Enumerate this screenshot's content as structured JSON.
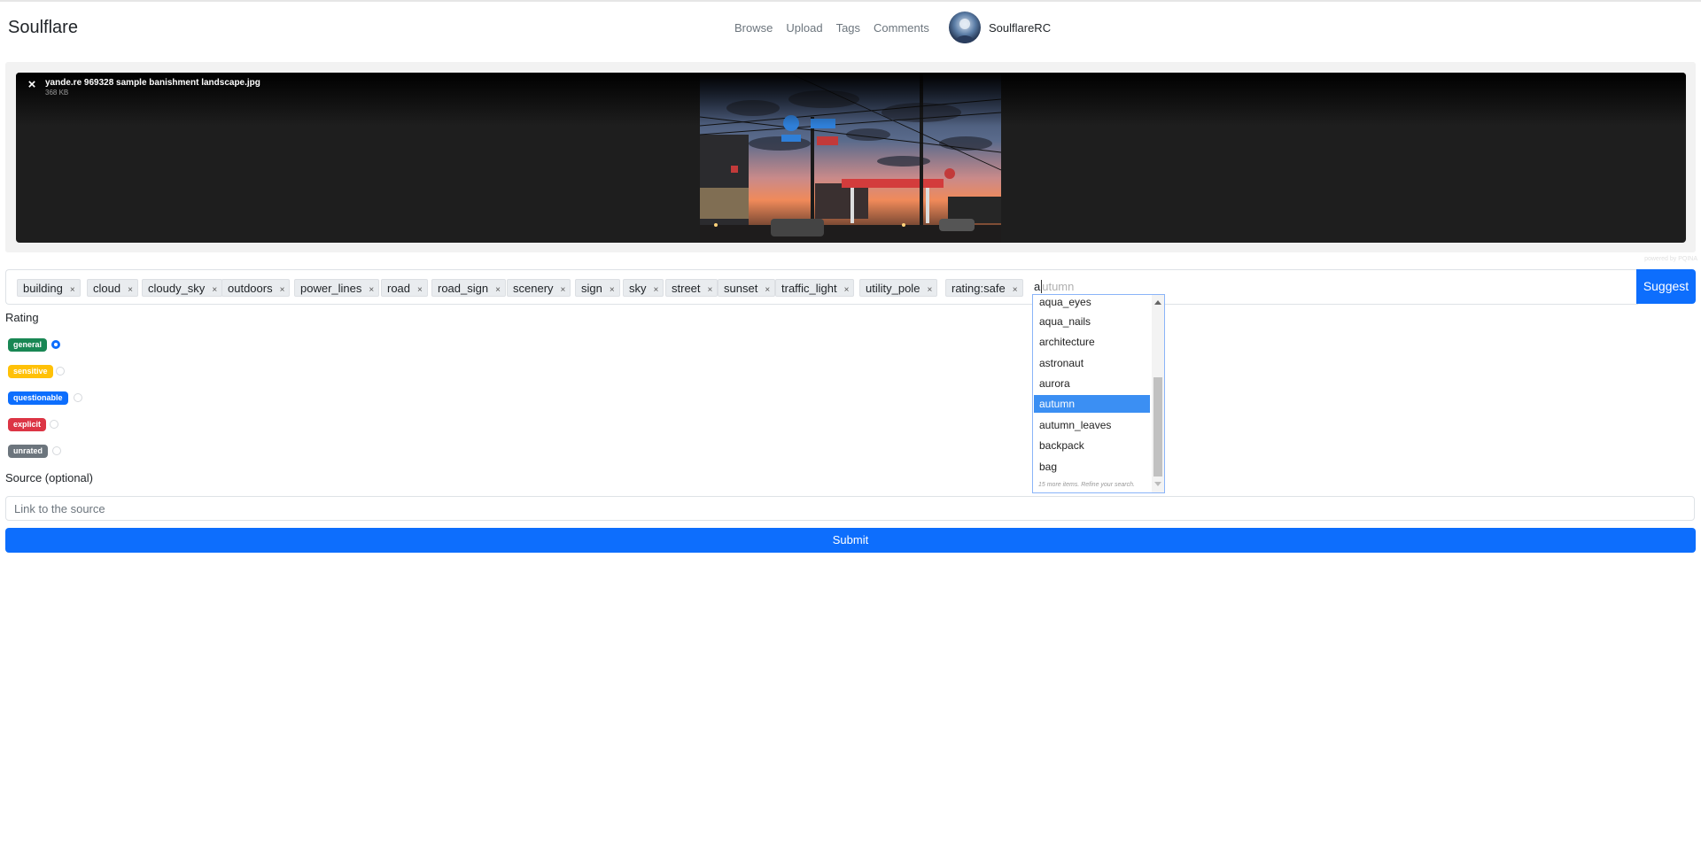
{
  "app": {
    "title": "Soulflare"
  },
  "nav": {
    "links": [
      "Browse",
      "Upload",
      "Tags",
      "Comments"
    ],
    "username": "SoulflareRC"
  },
  "upload": {
    "file_name": "yande.re 969328 sample banishment landscape.jpg",
    "file_size": "368 KB",
    "remove_label": "×",
    "credit": "powered by PQINA"
  },
  "tags": {
    "items": [
      "building",
      "cloud",
      "cloudy_sky",
      "outdoors",
      "power_lines",
      "road",
      "road_sign",
      "scenery",
      "sign",
      "sky",
      "street",
      "sunset",
      "traffic_light",
      "utility_pole",
      "rating:safe"
    ],
    "remove_label": "×",
    "input_typed": "a",
    "input_hint": "utumn",
    "suggest_label": "Suggest"
  },
  "autocomplete": {
    "options": [
      "aqua_eyes",
      "aqua_nails",
      "architecture",
      "astronaut",
      "aurora",
      "autumn",
      "autumn_leaves",
      "backpack",
      "bag"
    ],
    "selected": "autumn",
    "more_text": "15 more items. Refine your search."
  },
  "rating": {
    "label": "Rating",
    "options": [
      {
        "label": "general",
        "color": "#198754",
        "checked": true
      },
      {
        "label": "sensitive",
        "color": "#ffc107",
        "checked": false
      },
      {
        "label": "questionable",
        "color": "#0d6efd",
        "checked": false
      },
      {
        "label": "explicit",
        "color": "#dc3545",
        "checked": false
      },
      {
        "label": "unrated",
        "color": "#6c757d",
        "checked": false
      }
    ]
  },
  "source": {
    "label": "Source (optional)",
    "placeholder": "Link to the source",
    "value": ""
  },
  "submit_label": "Submit",
  "colors": {
    "primary": "#0d6efd",
    "tag_bg": "#e9ecef",
    "upload_bg": "#1e1e1e"
  }
}
